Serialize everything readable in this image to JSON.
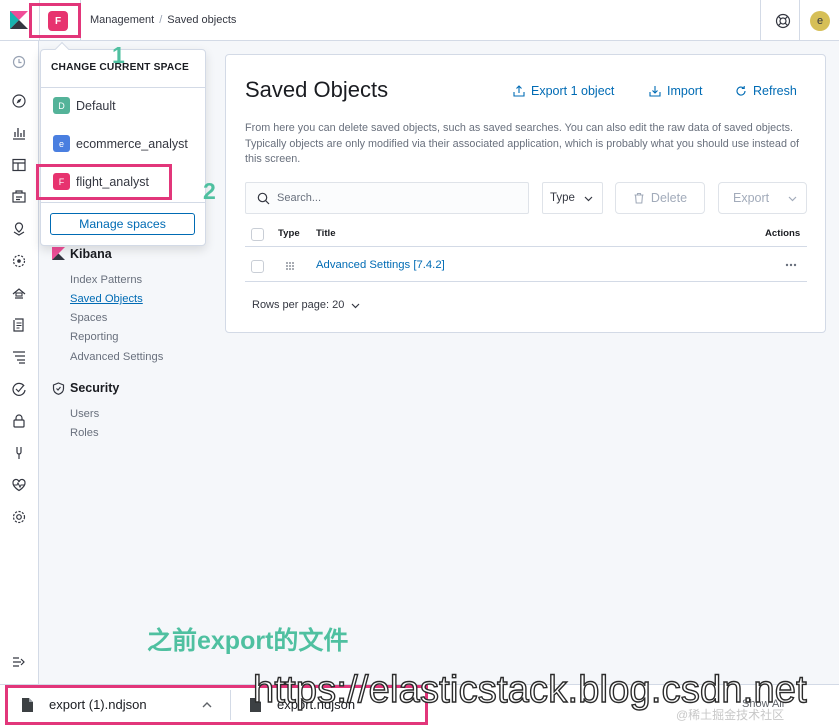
{
  "header": {
    "space_initial": "F",
    "breadcrumb": [
      "Management",
      "Saved objects"
    ],
    "avatar_initial": "e",
    "logo": "kibana-logo-icon",
    "help_icon": "help-icon"
  },
  "leftnav": {
    "icons": [
      "clock-icon",
      "discover-icon",
      "visualize-icon",
      "dashboard-icon",
      "canvas-icon",
      "maps-icon",
      "ml-icon",
      "infrastructure-icon",
      "logs-icon",
      "apm-icon",
      "uptime-icon",
      "siem-icon",
      "devtools-icon",
      "monitoring-icon",
      "management-icon",
      "collapse-icon"
    ]
  },
  "space_menu": {
    "title": "CHANGE CURRENT SPACE",
    "spaces": [
      {
        "initial": "D",
        "name": "Default",
        "color": "#54b399"
      },
      {
        "initial": "e",
        "name": "ecommerce_analyst",
        "color": "#4a7fe0"
      },
      {
        "initial": "F",
        "name": "flight_analyst",
        "color": "#e7336f"
      }
    ],
    "manage_label": "Manage spaces"
  },
  "sidebar": {
    "kibana_title": "Kibana",
    "kibana_links": [
      "Index Patterns",
      "Saved Objects",
      "Spaces",
      "Reporting",
      "Advanced Settings"
    ],
    "active_link": "Saved Objects",
    "security_title": "Security",
    "security_links": [
      "Users",
      "Roles"
    ]
  },
  "main": {
    "title": "Saved Objects",
    "actions": {
      "export": "Export 1 object",
      "import": "Import",
      "refresh": "Refresh"
    },
    "description": "From here you can delete saved objects, such as saved searches. You can also edit the raw data of saved objects. Typically objects are only modified via their associated application, which is probably what you should use instead of this screen.",
    "search_placeholder": "Search...",
    "type_filter": "Type",
    "delete_label": "Delete",
    "export_label": "Export",
    "columns": {
      "type": "Type",
      "title": "Title",
      "actions": "Actions"
    },
    "rows": [
      {
        "title": "Advanced Settings [7.4.2]"
      }
    ],
    "rows_per_page": "Rows per page: 20"
  },
  "annotations": {
    "step1": "1",
    "step2": "2",
    "note": "之前export的文件",
    "highlight_color": "#e2367a",
    "note_color": "#4fc0a0"
  },
  "downloads": {
    "items": [
      "export (1).ndjson",
      "export.ndjson"
    ],
    "show_all": "Show All"
  },
  "watermark": {
    "url": "https://elasticstack.blog.csdn.net",
    "small": "@稀土掘金技术社区"
  }
}
